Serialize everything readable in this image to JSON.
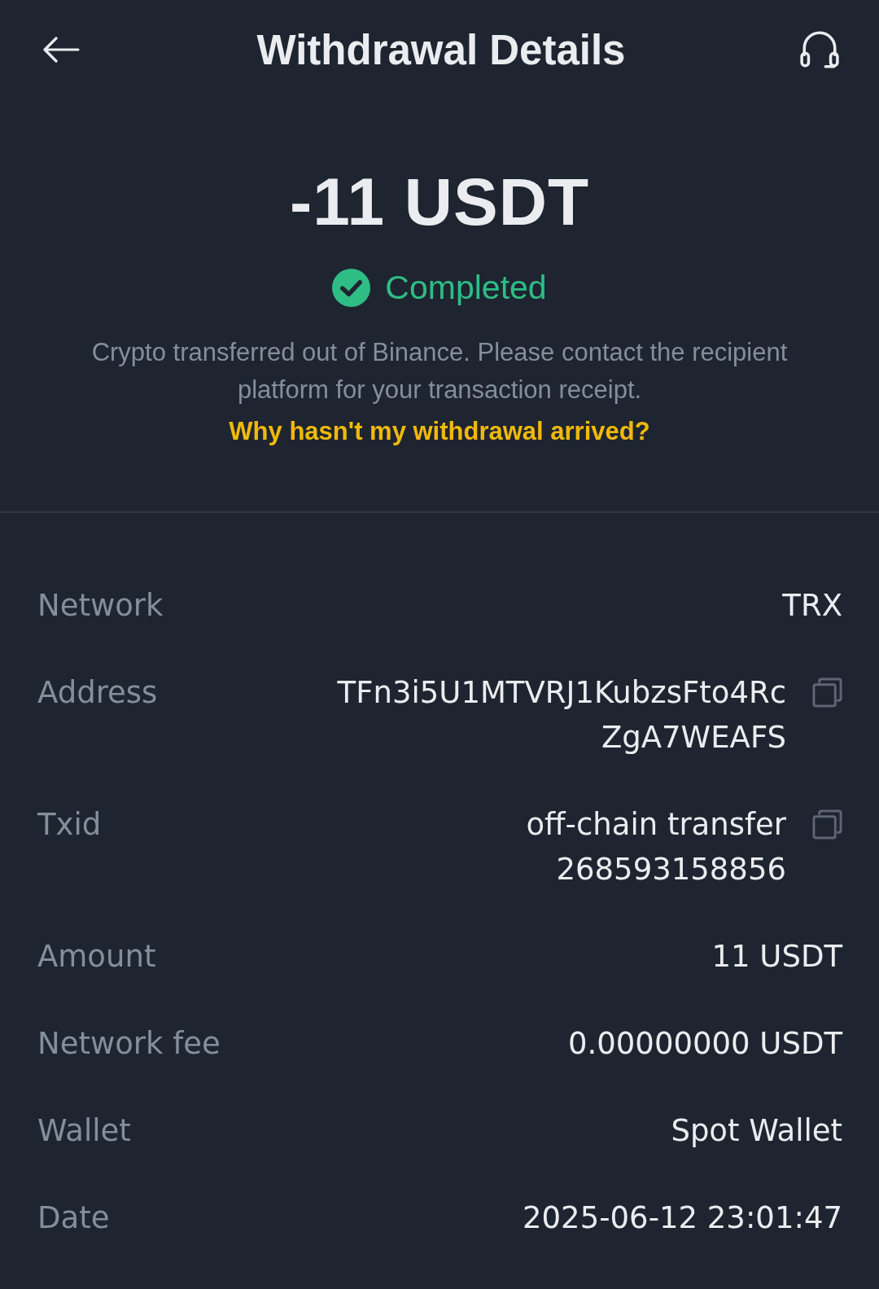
{
  "header": {
    "title": "Withdrawal Details"
  },
  "summary": {
    "amount": "-11 USDT",
    "status": {
      "label": "Completed",
      "kind": "completed"
    },
    "description": "Crypto transferred out of Binance. Please contact the recipient platform for your transaction receipt.",
    "help_link": "Why hasn't my withdrawal arrived?"
  },
  "details": [
    {
      "label": "Network",
      "value": "TRX",
      "copyable": false
    },
    {
      "label": "Address",
      "value": "TFn3i5U1MTVRJ1KubzsFto4RcZgA7WEAFS",
      "copyable": true
    },
    {
      "label": "Txid",
      "value": "off-chain transfer 268593158856",
      "copyable": true
    },
    {
      "label": "Amount",
      "value": "11 USDT",
      "copyable": false
    },
    {
      "label": "Network fee",
      "value": "0.00000000 USDT",
      "copyable": false
    },
    {
      "label": "Wallet",
      "value": "Spot Wallet",
      "copyable": false
    },
    {
      "label": "Date",
      "value": "2025-06-12 23:01:47",
      "copyable": false
    }
  ]
}
